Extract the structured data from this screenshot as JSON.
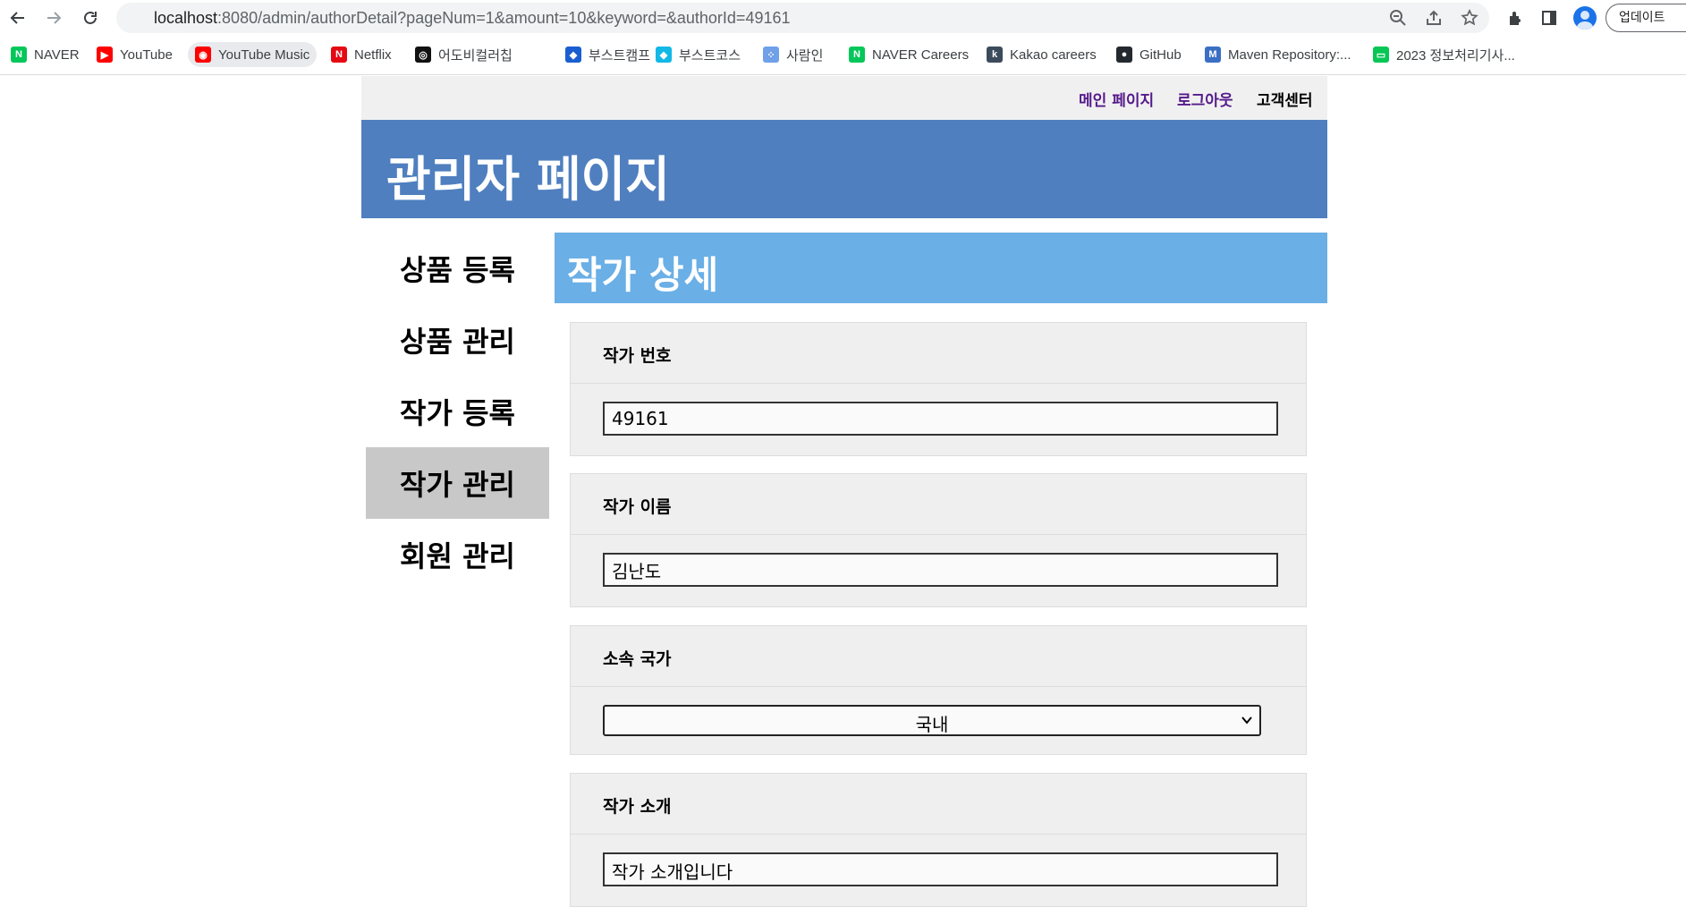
{
  "browser": {
    "url_host": "localhost",
    "url_rest": ":8080/admin/authorDetail?pageNum=1&amount=10&keyword=&authorId=49161",
    "update_label": "업데이트",
    "bookmarks": [
      {
        "label": "NAVER",
        "icon": "naver-icon",
        "color": "#03c75a",
        "glyph": "N"
      },
      {
        "label": "YouTube",
        "icon": "youtube-icon",
        "color": "#ff0000",
        "glyph": "▶"
      },
      {
        "label": "YouTube Music",
        "icon": "youtube-music-icon",
        "color": "#ff0000",
        "glyph": "◉"
      },
      {
        "label": "Netflix",
        "icon": "netflix-icon",
        "color": "#e50914",
        "glyph": "N"
      },
      {
        "label": "어도비컬러칩",
        "icon": "adobe-color-icon",
        "color": "#111111",
        "glyph": "◎"
      },
      {
        "label": "부스트캠프",
        "icon": "boostcamp-icon",
        "color": "#1a5fd1",
        "glyph": "◆"
      },
      {
        "label": "부스트코스",
        "icon": "boostcourse-icon",
        "color": "#12b8e6",
        "glyph": "◆"
      },
      {
        "label": "사람인",
        "icon": "saramin-icon",
        "color": "#6fa0e8",
        "glyph": "⁘"
      },
      {
        "label": "NAVER Careers",
        "icon": "naver-careers-icon",
        "color": "#03c75a",
        "glyph": "N"
      },
      {
        "label": "Kakao careers",
        "icon": "kakao-careers-icon",
        "color": "#3c4b5c",
        "glyph": "k"
      },
      {
        "label": "GitHub",
        "icon": "github-icon",
        "color": "#24292f",
        "glyph": "●"
      },
      {
        "label": "Maven Repository:...",
        "icon": "maven-icon",
        "color": "#3b6fc4",
        "glyph": "M"
      },
      {
        "label": "2023 정보처리기사...",
        "icon": "line-icon",
        "color": "#06c755",
        "glyph": "▭"
      }
    ]
  },
  "topnav": {
    "main_page": "메인 페이지",
    "logout": "로그아웃",
    "support": "고객센터"
  },
  "banner": {
    "title": "관리자 페이지"
  },
  "sidebar": {
    "items": [
      {
        "label": "상품 등록",
        "active": false
      },
      {
        "label": "상품 관리",
        "active": false
      },
      {
        "label": "작가 등록",
        "active": false
      },
      {
        "label": "작가 관리",
        "active": true
      },
      {
        "label": "회원 관리",
        "active": false
      }
    ]
  },
  "section": {
    "title": "작가 상세"
  },
  "form": {
    "author_id_label": "작가 번호",
    "author_id_value": "49161",
    "author_name_label": "작가 이름",
    "author_name_value": "김난도",
    "nation_label": "소속 국가",
    "nation_value": "국내",
    "intro_label": "작가 소개",
    "intro_value": "작가 소개입니다"
  },
  "colors": {
    "banner": "#4f7fbf",
    "section_head": "#6aafe6",
    "sidebar_active": "#c8c8c8"
  }
}
